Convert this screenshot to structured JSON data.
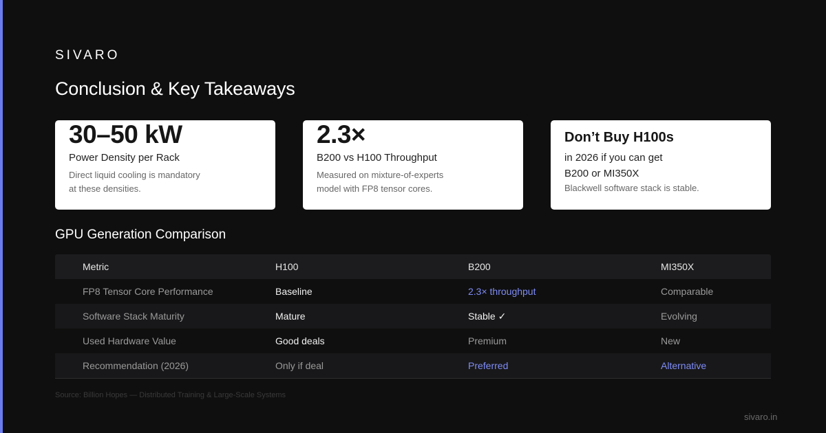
{
  "brand": "SIVARO",
  "title": "Conclusion & Key Takeaways",
  "cards": [
    {
      "headline": "30–50 kW",
      "label": "Power Density per Rack",
      "desc_line1": "Direct liquid cooling is mandatory",
      "desc_line2": "at these densities."
    },
    {
      "headline": "2.3×",
      "label": "B200 vs H100 Throughput",
      "desc_line1": "Measured on mixture-of-experts",
      "desc_line2": "model with FP8 tensor cores."
    },
    {
      "headline": "Don’t Buy H100s",
      "line1": "in 2026 if you can get",
      "line2": "B200 or MI350X",
      "desc": "Blackwell software stack is stable."
    }
  ],
  "table": {
    "title": "GPU Generation Comparison",
    "headers": [
      "Metric",
      "H100",
      "B200",
      "MI350X"
    ],
    "rows": [
      [
        "FP8 Tensor Core Performance",
        "Baseline",
        "2.3× throughput",
        "Comparable"
      ],
      [
        "Software Stack Maturity",
        "Mature",
        "Stable ✓",
        "Evolving"
      ],
      [
        "Used Hardware Value",
        "Good deals",
        "Premium",
        "New"
      ],
      [
        "Recommendation (2026)",
        "Only if deal",
        "Preferred",
        "Alternative"
      ]
    ]
  },
  "source": "Source: Billion Hopes — Distributed Training & Large-Scale Systems",
  "footer": "sivaro.in",
  "colors": {
    "background": "#0f0f0f",
    "accent": "#7f8cf5",
    "accent_bar": "#6b7cf0",
    "card": "#ffffff"
  }
}
